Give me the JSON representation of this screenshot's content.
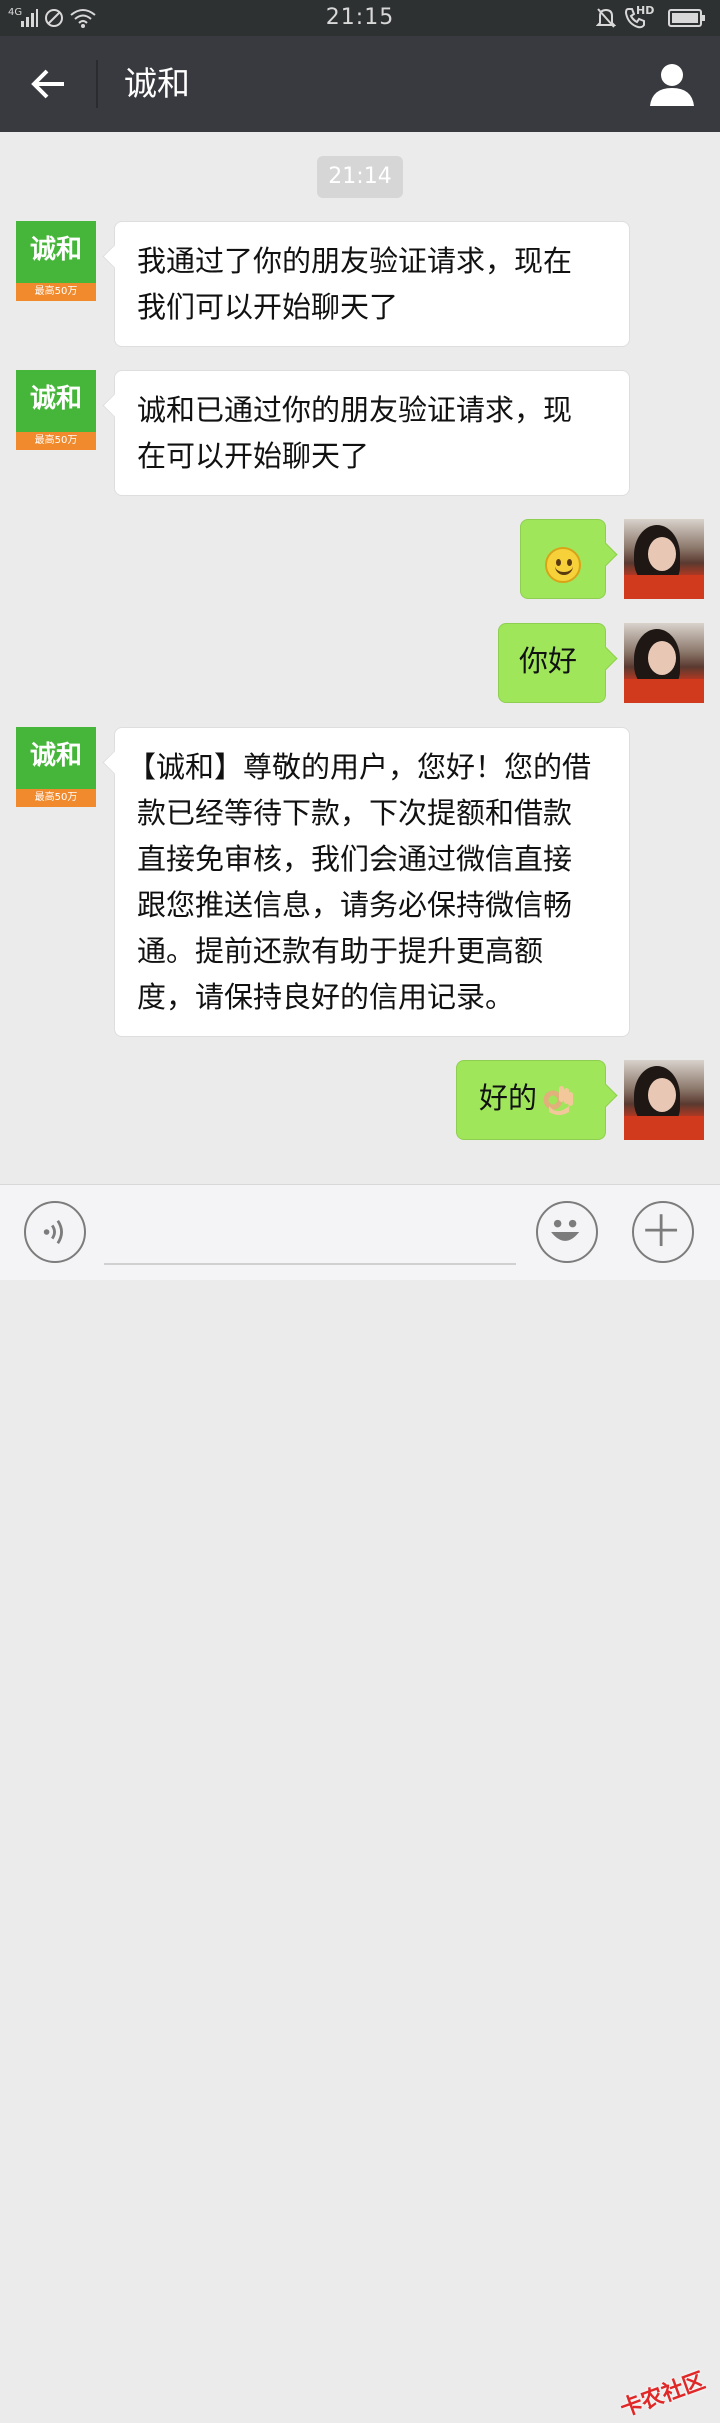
{
  "status_bar": {
    "network": "4G",
    "time": "21:15",
    "hd_label": "HD"
  },
  "title_bar": {
    "title": "诚和"
  },
  "chat": {
    "timestamp": "21:14",
    "brand_avatar": {
      "text": "诚和",
      "strip_text": "最高50万"
    },
    "messages": [
      {
        "side": "in",
        "text_line1": "我通过了你的朋友验证请求，现在",
        "text_line2": "我们可以开始聊天了"
      },
      {
        "side": "in",
        "text_line1": "诚和已通过你的朋友验证请求，现",
        "text_line2": "在可以开始聊天了"
      },
      {
        "side": "out",
        "emoji": "smile-emoji"
      },
      {
        "side": "out",
        "text": "你好"
      },
      {
        "side": "in",
        "lines": [
          "【诚和】尊敬的用户，您好！您的借",
          "款已经等待下款，下次提额和借款",
          "直接免审核，我们会通过微信直接",
          "跟您推送信息，请务必保持微信畅",
          "通。提前还款有助于提升更高额",
          "度，请保持良好的信用记录。"
        ]
      },
      {
        "side": "out",
        "text": "好的",
        "emoji": "ok-hand-emoji"
      }
    ]
  },
  "input_bar": {
    "text_value": "",
    "watermark": "卡农社区"
  }
}
